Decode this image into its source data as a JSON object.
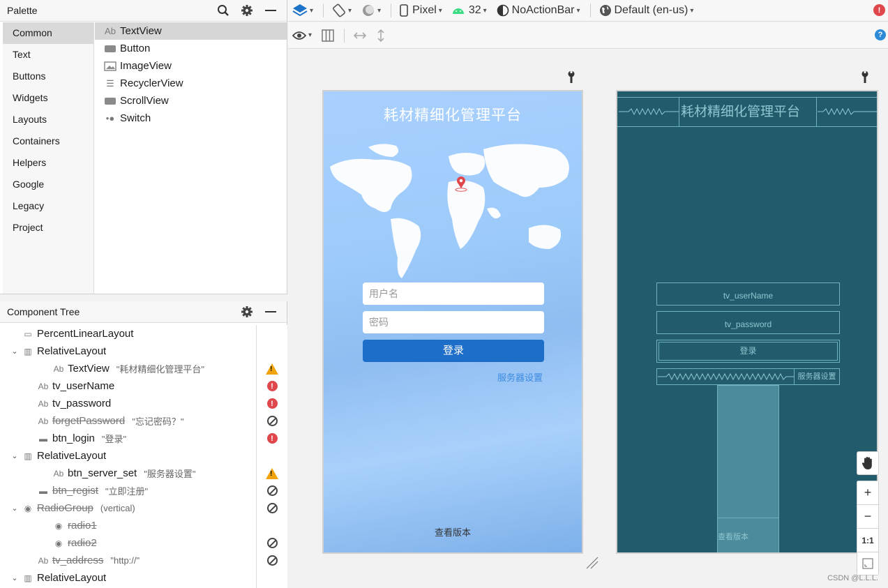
{
  "palette": {
    "title": "Palette",
    "categories": [
      "Common",
      "Text",
      "Buttons",
      "Widgets",
      "Layouts",
      "Containers",
      "Helpers",
      "Google",
      "Legacy",
      "Project"
    ],
    "selected_category": "Common",
    "items": [
      {
        "label": "TextView",
        "icon": "textview-icon",
        "glyph": "Ab"
      },
      {
        "label": "Button",
        "icon": "button-icon",
        "glyph": ""
      },
      {
        "label": "ImageView",
        "icon": "imageview-icon",
        "glyph": ""
      },
      {
        "label": "RecyclerView",
        "icon": "recyclerview-icon",
        "glyph": "☰"
      },
      {
        "label": "ScrollView",
        "icon": "scrollview-icon",
        "glyph": ""
      },
      {
        "label": "Switch",
        "icon": "switch-icon",
        "glyph": "•●"
      }
    ]
  },
  "tree": {
    "title": "Component Tree",
    "rows": [
      {
        "name": "PercentLinearLayout",
        "hint": "",
        "indent": 0,
        "arrow": "",
        "icon": "layout-icon",
        "glyph": "▭",
        "status": "",
        "disabled": false
      },
      {
        "name": "RelativeLayout",
        "hint": "",
        "indent": 0,
        "arrow": "⌄",
        "icon": "relativelayout-icon",
        "glyph": "▥",
        "status": "",
        "disabled": false
      },
      {
        "name": "TextView",
        "hint": "\"耗材精细化管理平台\"",
        "indent": 2,
        "arrow": "",
        "icon": "textview-icon",
        "glyph": "Ab",
        "status": "warning",
        "disabled": false
      },
      {
        "name": "tv_userName",
        "hint": "",
        "indent": 1,
        "arrow": "",
        "icon": "edittext-icon",
        "glyph": "Ab",
        "status": "error",
        "disabled": false
      },
      {
        "name": "tv_password",
        "hint": "",
        "indent": 1,
        "arrow": "",
        "icon": "edittext-icon",
        "glyph": "Ab",
        "status": "error",
        "disabled": false
      },
      {
        "name": "forgetPassword",
        "hint": "\"忘记密码？\"",
        "indent": 1,
        "arrow": "",
        "icon": "textview-icon",
        "glyph": "Ab",
        "status": "hidden",
        "disabled": true
      },
      {
        "name": "btn_login",
        "hint": "\"登录\"",
        "indent": 1,
        "arrow": "",
        "icon": "button-icon",
        "glyph": "▬",
        "status": "error",
        "disabled": false
      },
      {
        "name": "RelativeLayout",
        "hint": "",
        "indent": 0,
        "arrow": "⌄",
        "icon": "relativelayout-icon",
        "glyph": "▥",
        "status": "",
        "disabled": false
      },
      {
        "name": "btn_server_set",
        "hint": "\"服务器设置\"",
        "indent": 2,
        "arrow": "",
        "icon": "textview-icon",
        "glyph": "Ab",
        "status": "warning",
        "disabled": false
      },
      {
        "name": "btn_regist",
        "hint": "\"立即注册\"",
        "indent": 1,
        "arrow": "",
        "icon": "button-icon",
        "glyph": "▬",
        "status": "hidden",
        "disabled": true
      },
      {
        "name": "RadioGroup",
        "hint": "(vertical)",
        "indent": 0,
        "arrow": "⌄",
        "icon": "radiogroup-icon",
        "glyph": "◉",
        "status": "hidden",
        "disabled": true
      },
      {
        "name": "radio1",
        "hint": "",
        "indent": 2,
        "arrow": "",
        "icon": "radiobutton-icon",
        "glyph": "◉",
        "status": "",
        "disabled": true
      },
      {
        "name": "radio2",
        "hint": "",
        "indent": 2,
        "arrow": "",
        "icon": "radiobutton-icon",
        "glyph": "◉",
        "status": "hidden",
        "disabled": true
      },
      {
        "name": "tv_address",
        "hint": "\"http://\"",
        "indent": 1,
        "arrow": "",
        "icon": "edittext-icon",
        "glyph": "Ab",
        "status": "hidden",
        "disabled": true
      },
      {
        "name": "RelativeLayout",
        "hint": "",
        "indent": 0,
        "arrow": "⌄",
        "icon": "relativelayout-icon",
        "glyph": "▥",
        "status": "",
        "disabled": false
      }
    ]
  },
  "toolbar": {
    "device": "Pixel",
    "api": "32",
    "theme": "NoActionBar",
    "locale": "Default (en-us)"
  },
  "design": {
    "title": "耗材精细化管理平台",
    "username_placeholder": "用户名",
    "password_placeholder": "密码",
    "login": "登录",
    "server_settings": "服务器设置",
    "version": "查看版本"
  },
  "blueprint": {
    "title": "耗材精细化管理平台",
    "username": "tv_userName",
    "password": "tv_password",
    "login": "登录",
    "server_settings": "服务器设置",
    "version": "查看版本"
  },
  "zoom": {
    "one_to_one": "1:1"
  },
  "watermark": "CSDN @L.L.L."
}
